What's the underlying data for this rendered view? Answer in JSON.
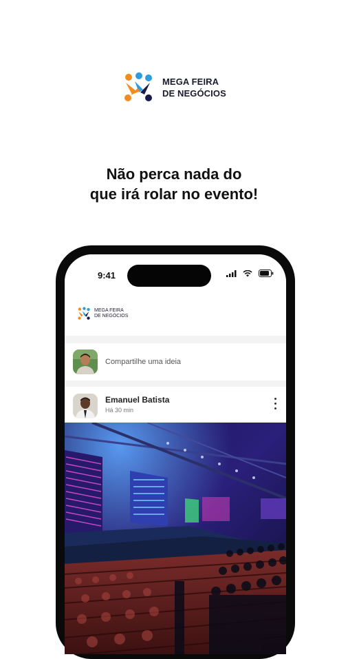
{
  "brand": {
    "line1": "MEGA FEIRA",
    "line2": "DE NEGÓCIOS"
  },
  "headline": {
    "line1": "Não perca nada do",
    "line2": "que irá rolar no evento!"
  },
  "phone": {
    "status_time": "9:41",
    "app_logo": {
      "line1": "MEGA FEIRA",
      "line2": "DE NEGÓCIOS"
    },
    "composer_placeholder": "Compartilhe uma ideia",
    "post": {
      "author": "Emanuel Batista",
      "time": "Há 30 min"
    }
  },
  "colors": {
    "logo_orange": "#F28C1E",
    "logo_blue": "#2D9CDB",
    "logo_navy": "#1B1B4B",
    "stage_purple": "#5a2da0",
    "stage_blue": "#1e3aa0"
  },
  "icons": [
    "brand-logo-icon",
    "signal-icon",
    "wifi-icon",
    "battery-icon",
    "more-vertical-icon"
  ]
}
